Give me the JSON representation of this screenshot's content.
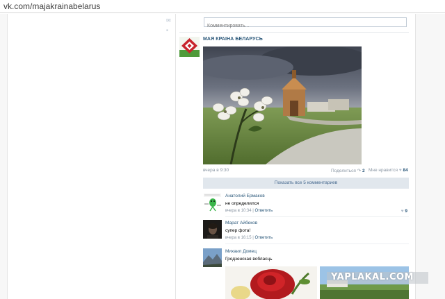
{
  "browser": {
    "url": "vk.com/majakrainabelarus"
  },
  "comment_input": {
    "placeholder": "Комментировать..."
  },
  "post": {
    "group_name": "МАЯ КРАІНА БЕЛАРУСЬ",
    "time": "вчера в 9:30",
    "share_label": "Поделиться",
    "share_count": "2",
    "like_label": "Мне нравится",
    "like_count": "84"
  },
  "show_all_comments": "Показать все 5 комментариев",
  "comments": [
    {
      "author": "Анатолий Ермаков",
      "text": "не определился",
      "time": "вчера в 10:34",
      "reply": "Ответить",
      "likes": "9"
    },
    {
      "author": "Марат Айбеков",
      "text": "супер фота!",
      "time": "вчера в 16:15",
      "reply": "Ответить",
      "likes": ""
    },
    {
      "author": "Михаил Домец",
      "text": "Гродзенская вобласць",
      "time": "",
      "reply": "",
      "likes": ""
    }
  ],
  "watermark": "YAPLAKAL.COM",
  "colors": {
    "link_blue": "#2b587a",
    "muted": "#8a96a3",
    "show_all_bg": "#e1e7ed"
  }
}
